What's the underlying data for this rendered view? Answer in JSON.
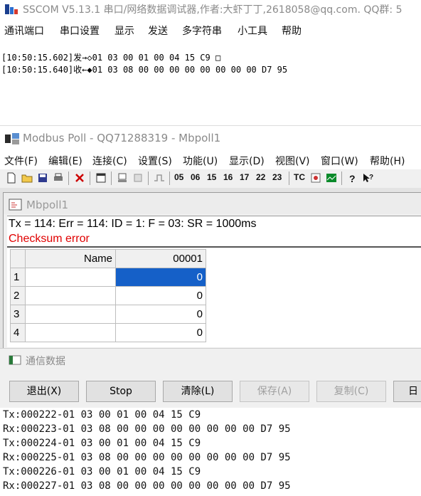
{
  "sscom": {
    "title": "SSCOM V5.13.1 串口/网络数据调试器,作者:大虾丁丁,2618058@qq.com. QQ群: 5",
    "menu": [
      "通讯端口",
      "串口设置",
      "显示",
      "发送",
      "多字符串",
      "小工具",
      "帮助"
    ],
    "log": [
      "[10:50:15.602]发→◇01 03 00 01 00 04 15 C9 □",
      "[10:50:15.640]收←◆01 03 08 00 00 00 00 00 00 00 00 D7 95"
    ]
  },
  "modbus": {
    "title": "Modbus Poll - QQ71288319 - Mbpoll1",
    "menu": [
      "文件(F)",
      "编辑(E)",
      "连接(C)",
      "设置(S)",
      "功能(U)",
      "显示(D)",
      "视图(V)",
      "窗口(W)",
      "帮助(H)"
    ],
    "toolbar_functions": [
      "05",
      "06",
      "15",
      "16",
      "17",
      "22",
      "23"
    ],
    "toolbar_tc": "TC",
    "child_title": "Mbpoll1",
    "status_line": "Tx = 114: Err = 114: ID = 1: F = 03: SR = 1000ms",
    "error_line": "Checksum error",
    "grid": {
      "headers": [
        "Name",
        "00001"
      ],
      "rows": [
        {
          "num": "1",
          "name": "",
          "value": "0"
        },
        {
          "num": "2",
          "name": "",
          "value": "0"
        },
        {
          "num": "3",
          "name": "",
          "value": "0"
        },
        {
          "num": "4",
          "name": "",
          "value": "0"
        }
      ]
    }
  },
  "comm": {
    "title": "通信数据",
    "buttons": [
      "退出(X)",
      "Stop",
      "清除(L)",
      "保存(A)",
      "复制(C)",
      "日"
    ],
    "log": [
      "Tx:000222-01 03 00 01 00 04 15 C9",
      "Rx:000223-01 03 08 00 00 00 00 00 00 00 00 D7 95",
      "Tx:000224-01 03 00 01 00 04 15 C9",
      "Rx:000225-01 03 08 00 00 00 00 00 00 00 00 D7 95",
      "Tx:000226-01 03 00 01 00 04 15 C9",
      "Rx:000227-01 03 08 00 00 00 00 00 00 00 00 D7 95"
    ]
  },
  "colors": {
    "selection": "#1560c8",
    "error": "#e00000"
  }
}
